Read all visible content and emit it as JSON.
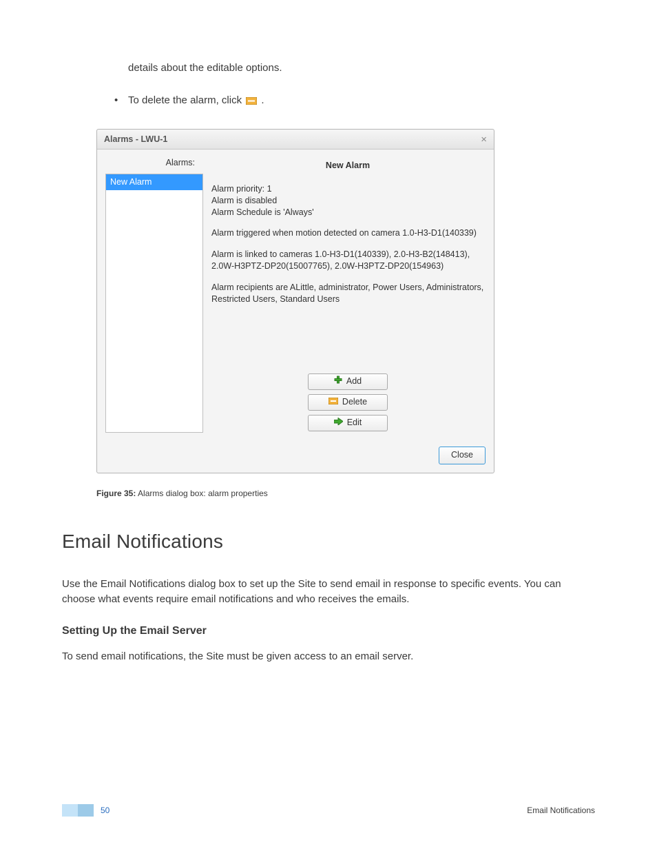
{
  "intro_line": "details about the editable options.",
  "bullet_prefix": "To delete the alarm, click ",
  "bullet_suffix": ".",
  "dialog": {
    "title": "Alarms - LWU-1",
    "left_label": "Alarms:",
    "list_selected": "New Alarm",
    "detail_title": "New Alarm",
    "lines": {
      "p1a": "Alarm priority: 1",
      "p1b": "Alarm is disabled",
      "p1c": "Alarm Schedule is 'Always'",
      "p2": "Alarm triggered when motion detected on camera 1.0-H3-D1(140339)",
      "p3": "Alarm is linked to cameras 1.0-H3-D1(140339), 2.0-H3-B2(148413), 2.0W-H3PTZ-DP20(15007765), 2.0W-H3PTZ-DP20(154963)",
      "p4": "Alarm recipients are ALittle, administrator, Power Users, Administrators, Restricted Users, Standard Users"
    },
    "buttons": {
      "add": "Add",
      "delete": "Delete",
      "edit": "Edit",
      "close": "Close"
    }
  },
  "figure_caption_bold": "Figure 35:",
  "figure_caption_rest": " Alarms dialog box: alarm properties",
  "section_heading": "Email Notifications",
  "section_para": "Use the Email Notifications dialog box to set up the Site to send email in response to specific events. You can choose what events require email notifications and who receives the emails.",
  "sub_heading": "Setting Up the Email Server",
  "sub_para": "To send email notifications, the Site must be given access to an email server.",
  "footer": {
    "page_number": "50",
    "right": "Email Notifications"
  }
}
